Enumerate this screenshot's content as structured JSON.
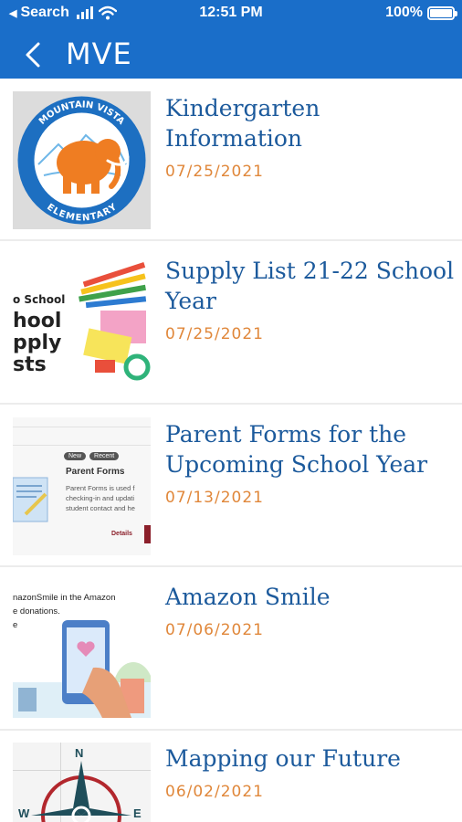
{
  "status_bar": {
    "back_app": "Search",
    "time": "12:51 PM",
    "battery": "100%"
  },
  "nav": {
    "title": "MVE"
  },
  "items": [
    {
      "title": "Kindergarten Information",
      "date": "07/25/2021",
      "logo_text_top": "MOUNTAIN VISTA",
      "logo_text_bottom": "ELEMENTARY"
    },
    {
      "title": "Supply List 21-22 School Year",
      "date": "07/25/2021",
      "thumb_lines": [
        "o School",
        "hool",
        "pply",
        "sts"
      ]
    },
    {
      "title": "Parent Forms for the Upcoming School Year",
      "date": "07/13/2021",
      "thumb_chip_1": "New",
      "thumb_chip_2": "Recent",
      "thumb_heading": "Parent Forms",
      "thumb_body": [
        "Parent Forms is used f",
        "checking-in and updati",
        "student contact and he"
      ],
      "thumb_link": "Details"
    },
    {
      "title": "Amazon Smile",
      "date": "07/06/2021",
      "thumb_lines": [
        "nazonSmile in the Amazon",
        "e donations.",
        "e"
      ]
    },
    {
      "title": "Mapping our Future",
      "date": "06/02/2021",
      "compass": [
        "N",
        "W",
        "E"
      ]
    }
  ],
  "colors": {
    "header": "#1a6ec9",
    "title": "#1c5a9c",
    "date": "#e0873a"
  }
}
